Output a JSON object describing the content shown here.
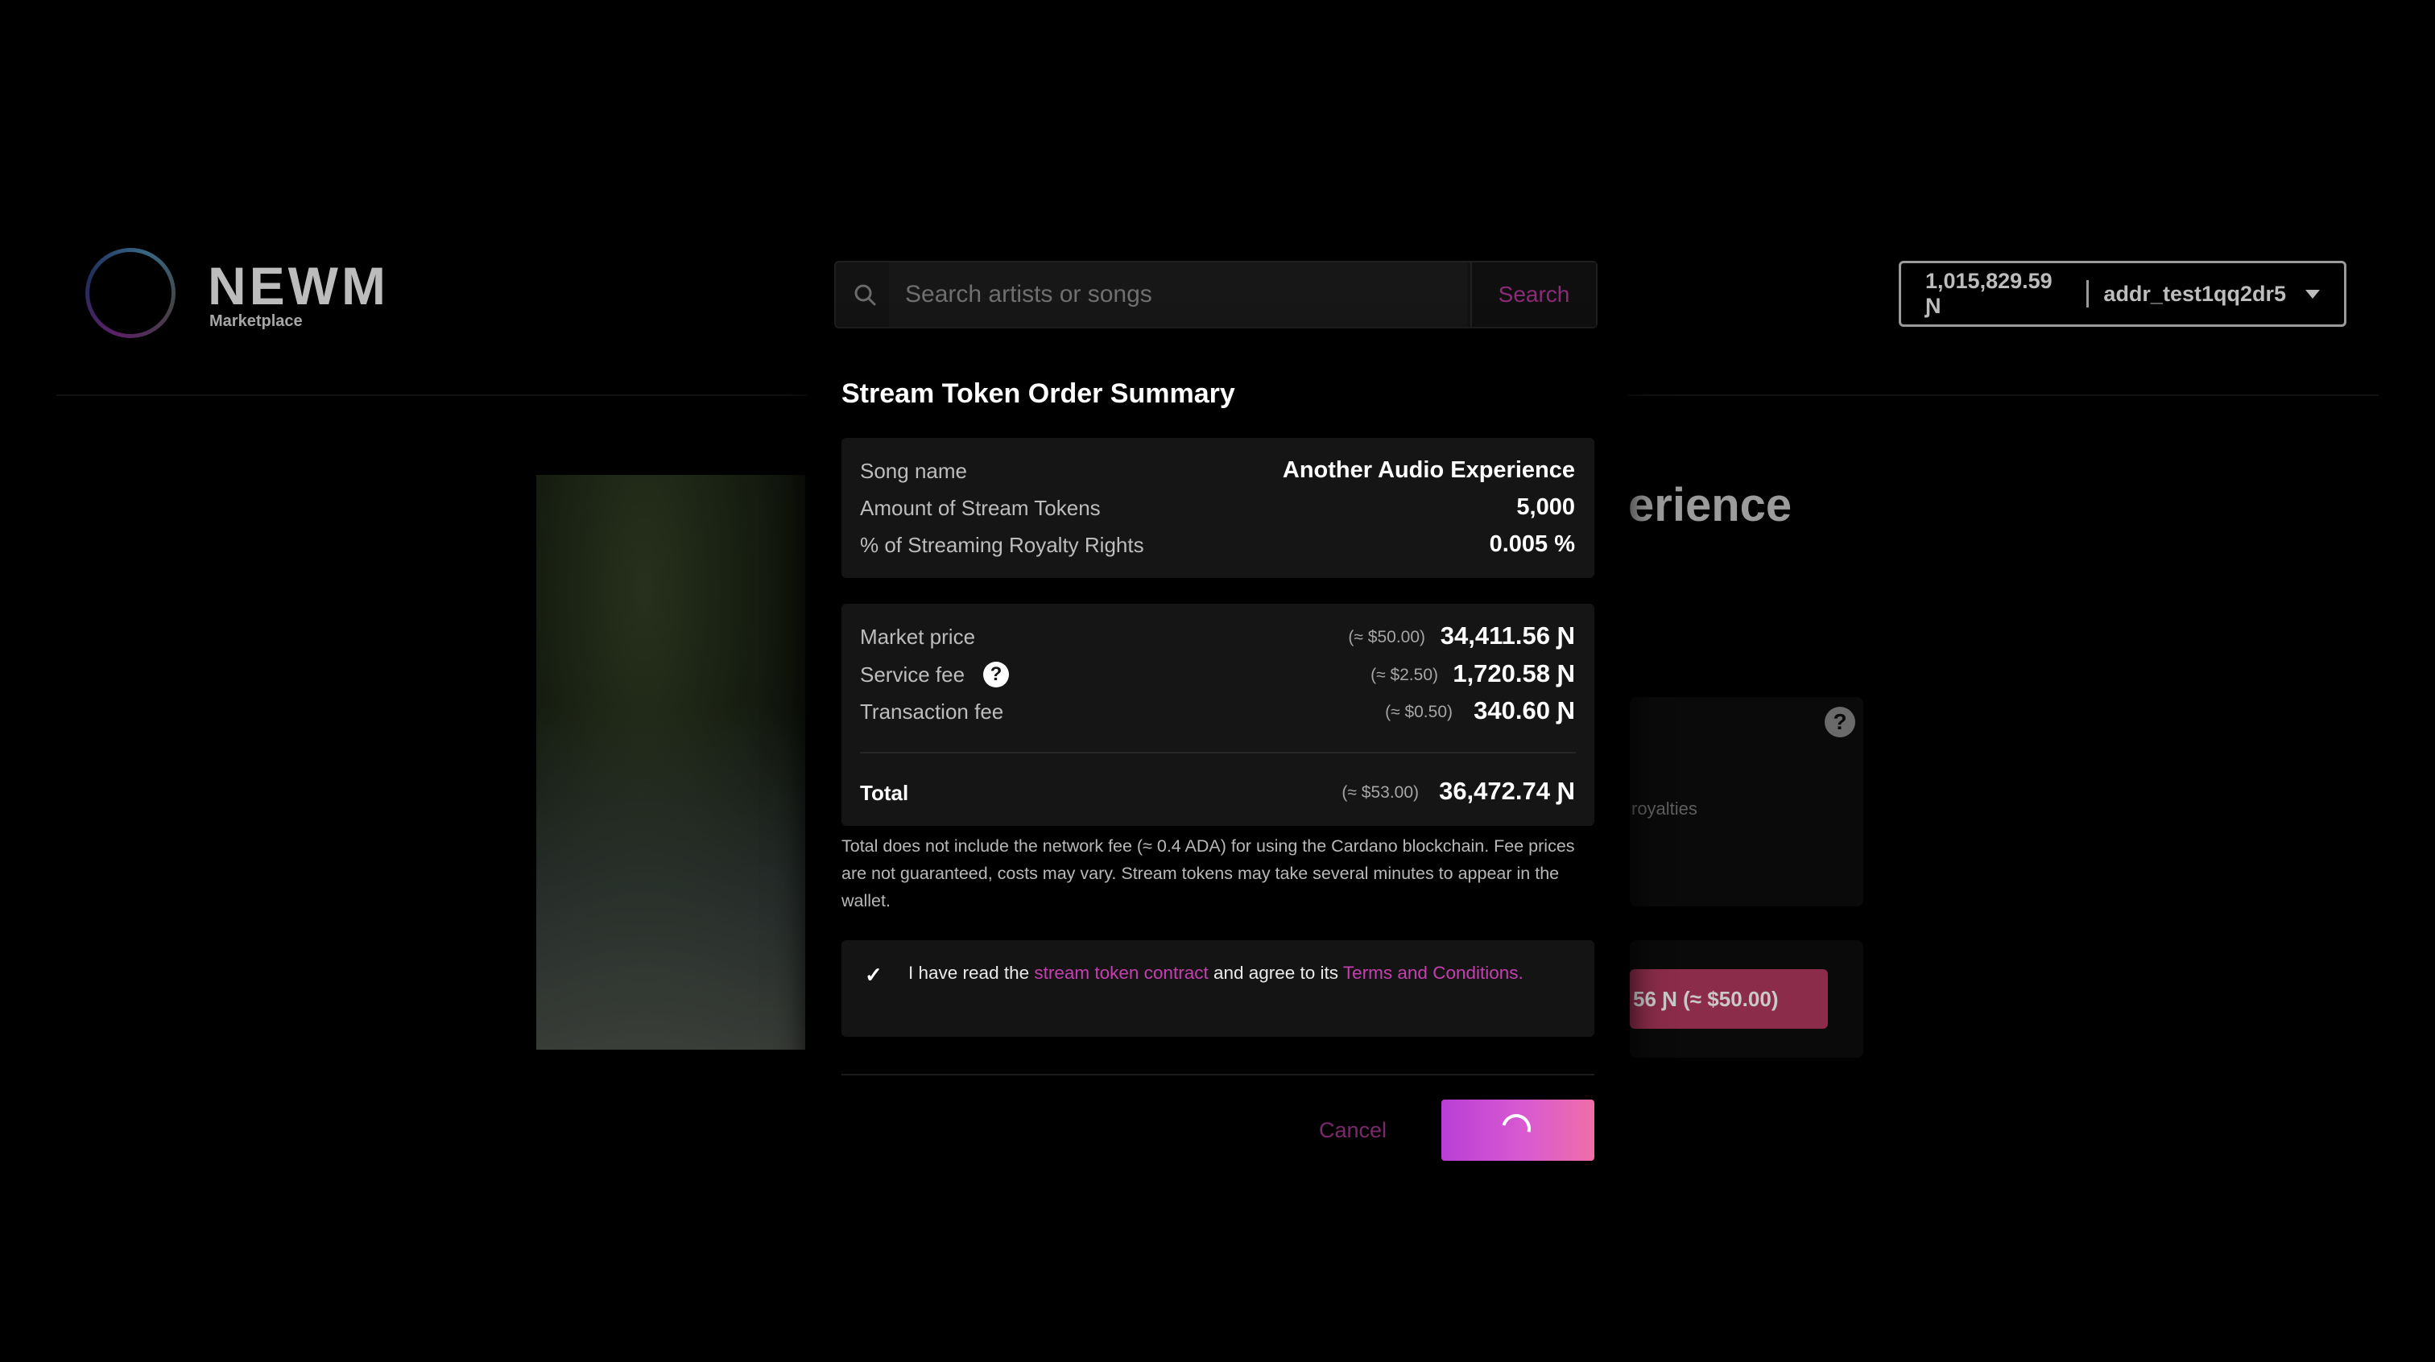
{
  "header": {
    "logo_word": "NEWM",
    "logo_sub": "Marketplace",
    "search": {
      "placeholder": "Search artists or songs",
      "button_label": "Search"
    },
    "wallet": {
      "balance": "1,015,829.59 Ɲ",
      "address": "addr_test1qq2dr5"
    }
  },
  "background": {
    "title_fragment": "erience",
    "royalties_fragment": "royalties",
    "buy_button_fragment": "56 Ɲ (≈ $50.00)",
    "help_glyph": "?"
  },
  "modal": {
    "title": "Stream Token Order Summary",
    "summary": [
      {
        "label": "Song name",
        "value": "Another Audio Experience"
      },
      {
        "label": "Amount of Stream Tokens",
        "value": "5,000"
      },
      {
        "label": "% of Streaming Royalty Rights",
        "value": "0.005 %"
      }
    ],
    "fees": [
      {
        "label": "Market price",
        "usd": "(≈ $50.00)",
        "amount": "34,411.56 Ɲ"
      },
      {
        "label": "Service fee",
        "usd": "(≈ $2.50)",
        "amount": "1,720.58 Ɲ",
        "help": "?"
      },
      {
        "label": "Transaction fee",
        "usd": "(≈ $0.50)",
        "amount": "340.60 Ɲ"
      }
    ],
    "total": {
      "label": "Total",
      "usd": "(≈ $53.00)",
      "amount": "36,472.74 Ɲ"
    },
    "note": "Total does not include the network fee (≈ 0.4 ADA) for using the Cardano blockchain. Fee prices are not guaranteed, costs may vary. Stream tokens may take several minutes to appear in the wallet.",
    "terms": {
      "checked": true,
      "check_glyph": "✓",
      "prefix": "I have read the ",
      "contract_link": "stream token contract",
      "middle": " and agree to its ",
      "terms_link": "Terms and Conditions."
    },
    "cancel_label": "Cancel",
    "confirm_state": "loading"
  },
  "colors": {
    "accent": "#c63fb0",
    "gradient_start": "#b93fd6",
    "gradient_end": "#ef6ea8"
  }
}
